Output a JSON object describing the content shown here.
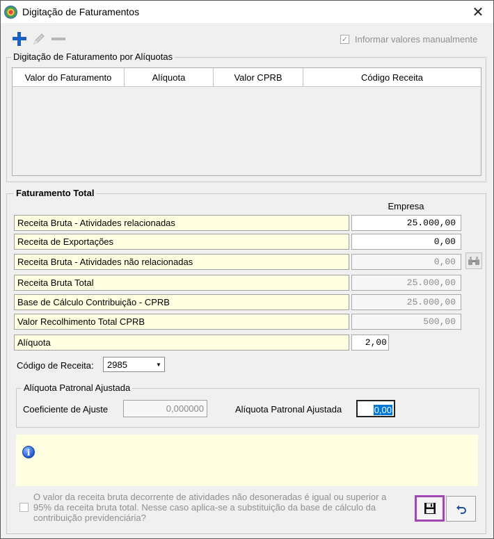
{
  "window": {
    "title": "Digitação de Faturamentos",
    "close_symbol": "✕"
  },
  "toolbar": {
    "add_icon": "plus-icon",
    "edit_icon": "pencil-icon",
    "remove_icon": "minus-icon",
    "manual_values_checked": true,
    "manual_values_label": "Informar valores manualmente"
  },
  "aliquotas_group": {
    "legend": "Digitação de Faturamento por Alíquotas",
    "columns": [
      "Valor do Faturamento",
      "Alíquota",
      "Valor CPRB",
      "Código Receita"
    ]
  },
  "total_group": {
    "legend": "Faturamento Total",
    "column_header": "Empresa",
    "rows": [
      {
        "label": "Receita Bruta - Atividades relacionadas",
        "value": "25.000,00"
      },
      {
        "label": "Receita de Exportações",
        "value": "0,00"
      },
      {
        "label": "Receita Bruta - Atividades não relacionadas",
        "value": "0,00"
      },
      {
        "label": "Receita Bruta Total",
        "value": "25.000,00"
      },
      {
        "label": "Base de Cálculo Contribuição - CPRB",
        "value": "25.000,00"
      },
      {
        "label": "Valor Recolhimento Total CPRB",
        "value": "500,00"
      },
      {
        "label": "Alíquota",
        "value": "2,00"
      }
    ],
    "codigo_receita_label": "Código de Receita:",
    "codigo_receita_value": "2985"
  },
  "patronal_group": {
    "legend": "Alíquota Patronal Ajustada",
    "coef_label": "Coeficiente de Ajuste",
    "coef_value": "0,000000",
    "aliquota_label": "Alíquota Patronal Ajustada",
    "aliquota_value": "0,00"
  },
  "info_panel": {
    "icon": "info-icon"
  },
  "note": {
    "checked": false,
    "text": "O valor da receita bruta decorrente de atividades não desoneradas é igual ou superior a 95% da receita bruta total. Nesse caso aplica-se a substituição da base de cálculo da contribuição previdenciária?"
  },
  "buttons": {
    "save_icon": "floppy-disk-icon",
    "undo_icon": "undo-icon"
  },
  "colors": {
    "highlight_border": "#a247b5",
    "label_background": "#ffffe1",
    "selection": "#0078d7"
  }
}
